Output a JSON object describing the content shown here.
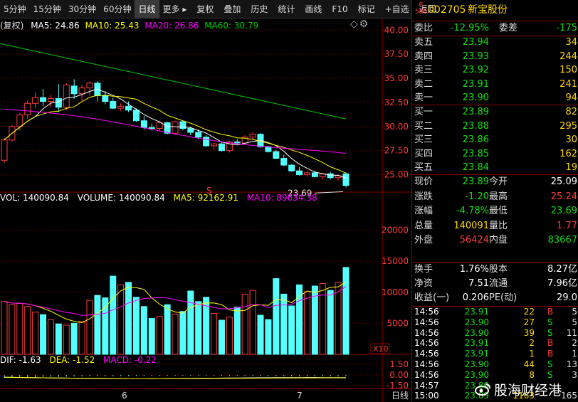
{
  "toolbar": {
    "periods": [
      "5分钟",
      "15分钟",
      "30分钟",
      "60分钟",
      "日线",
      "更多 ▸"
    ],
    "active_period": "日线",
    "actions": [
      "复权",
      "叠加",
      "历史",
      "统计",
      "画线",
      "F10",
      "标记",
      "+自选",
      "返回"
    ]
  },
  "main_chart": {
    "legend_prefix": "(复权)",
    "ma5": "MA5: 24.86",
    "ma10": "MA10: 25.43",
    "ma20": "MA20: 26.86",
    "ma60": "MA60: 30.79",
    "y_ticks": [
      "40.00",
      "37.50",
      "35.00",
      "32.50",
      "30.00",
      "27.50",
      "25.00"
    ],
    "last_price_label": "23.69",
    "marker": "S"
  },
  "volume_chart": {
    "vol": "VOL: 140090.84",
    "volume": "VOLUME: 140090.84",
    "ma5": "MA5: 92162.91",
    "ma10": "MA10: 89634.38",
    "y_ticks": [
      "20000",
      "15000",
      "10000",
      "5000"
    ],
    "scale_label": "X10"
  },
  "macd_chart": {
    "dif": "DIF: -1.63",
    "dea": "DEA: -1.52",
    "macd": "MACD: -0.22",
    "y_ticks": [
      "1.50",
      "0.00",
      "-1.50"
    ]
  },
  "date_axis": {
    "labels": [
      "6",
      "7"
    ],
    "period": "日线"
  },
  "colors": {
    "up": "#ff3b3b",
    "down": "#54ffff",
    "ma5": "#ffffff",
    "ma10": "#ffff00",
    "ma20": "#ff00ff",
    "ma60": "#00cc00",
    "frame": "#8a0000"
  },
  "quote": {
    "badge_top": "R",
    "badge_bottom": "500",
    "code": "002705",
    "name": "新宝股份",
    "weibi_label": "委比",
    "weibi": "-12.95%",
    "weicha_label": "委差",
    "weicha": "-175",
    "asks": [
      {
        "label": "卖五",
        "price": "23.94",
        "vol": "34"
      },
      {
        "label": "卖四",
        "price": "23.93",
        "vol": "244"
      },
      {
        "label": "卖三",
        "price": "23.92",
        "vol": "150"
      },
      {
        "label": "卖二",
        "price": "23.91",
        "vol": "241"
      },
      {
        "label": "卖一",
        "price": "23.90",
        "vol": "94"
      }
    ],
    "bids": [
      {
        "label": "买一",
        "price": "23.89",
        "vol": "82"
      },
      {
        "label": "买二",
        "price": "23.88",
        "vol": "295"
      },
      {
        "label": "买三",
        "price": "23.86",
        "vol": "30"
      },
      {
        "label": "买四",
        "price": "23.85",
        "vol": "162"
      },
      {
        "label": "买五",
        "price": "23.84",
        "vol": "19"
      }
    ],
    "stats": [
      {
        "l1": "现价",
        "v1": "23.89",
        "c1": "green",
        "l2": "今开",
        "v2": "25.09",
        "c2": "white"
      },
      {
        "l1": "涨跌",
        "v1": "-1.20",
        "c1": "green",
        "l2": "最高",
        "v2": "25.24",
        "c2": "red"
      },
      {
        "l1": "涨幅",
        "v1": "-4.78%",
        "c1": "green",
        "l2": "最低",
        "v2": "23.69",
        "c2": "green"
      },
      {
        "l1": "总量",
        "v1": "140091",
        "c1": "yellow",
        "l2": "量比",
        "v2": "1.77",
        "c2": "red"
      },
      {
        "l1": "外盘",
        "v1": "56424",
        "c1": "red",
        "l2": "内盘",
        "v2": "83667",
        "c2": "green"
      }
    ],
    "fund": [
      {
        "l1": "换手",
        "v1": "1.76%",
        "l2": "股本",
        "v2": "8.27亿"
      },
      {
        "l1": "净资",
        "v1": "7.51",
        "l2": "流通",
        "v2": "7.96亿"
      },
      {
        "l1": "收益(一)",
        "v1": "0.206",
        "l2": "PE(动)",
        "v2": "29.0"
      }
    ],
    "ticks": [
      {
        "t": "14:56",
        "p": "23.91",
        "v": "22",
        "bs": "B",
        "n": "5"
      },
      {
        "t": "14:56",
        "p": "23.90",
        "v": "27",
        "bs": "S",
        "n": "5"
      },
      {
        "t": "14:56",
        "p": "23.90",
        "v": "39",
        "bs": "S",
        "n": "11"
      },
      {
        "t": "14:56",
        "p": "23.91",
        "v": "2",
        "bs": "B",
        "n": "2"
      },
      {
        "t": "14:56",
        "p": "23.91",
        "v": "1",
        "bs": "B",
        "n": "1"
      },
      {
        "t": "14:56",
        "p": "23.90",
        "v": "44",
        "bs": "S",
        "n": "13"
      },
      {
        "t": "14:56",
        "p": "23.90",
        "v": "8",
        "bs": "S",
        "n": "3"
      },
      {
        "t": "14:57",
        "p": "23.89",
        "v": "",
        "bs": "",
        "n": ""
      },
      {
        "t": "15:00",
        "p": "23.89",
        "v": "1163",
        "bs": "",
        "n": "165"
      }
    ]
  },
  "watermark": "股海财经港"
}
